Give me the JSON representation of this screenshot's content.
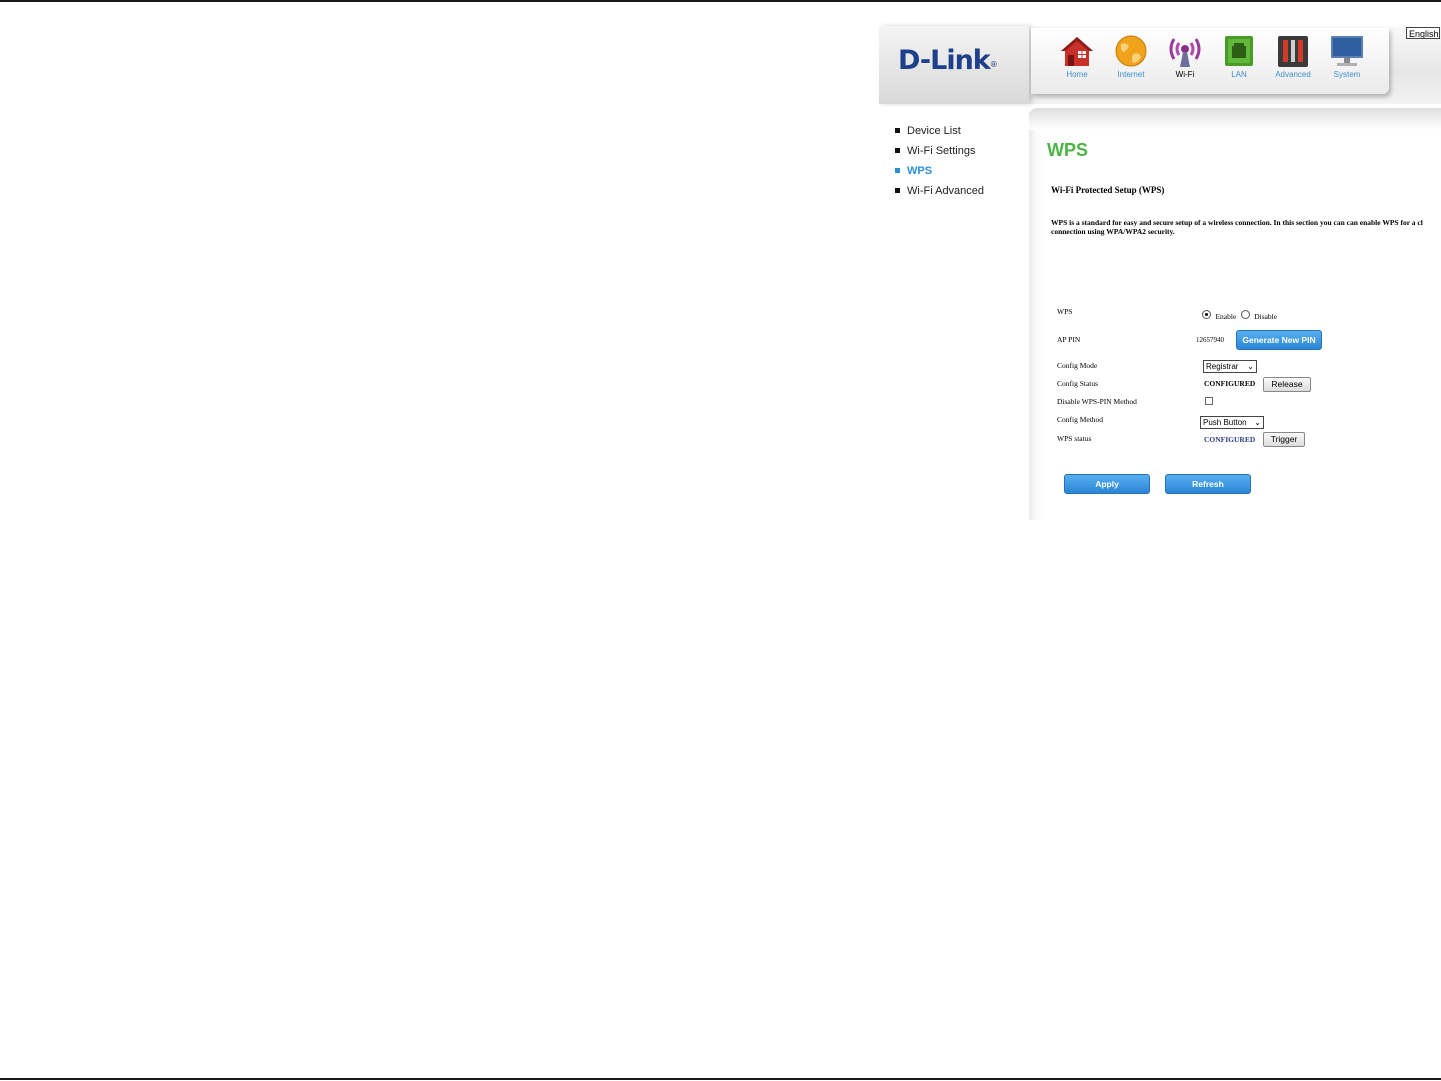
{
  "language": "English",
  "brand": {
    "logo_text": "D-Link",
    "reg_mark": "®"
  },
  "nav": [
    {
      "label": "Home",
      "icon": "home-icon"
    },
    {
      "label": "Internet",
      "icon": "globe-icon"
    },
    {
      "label": "Wi-Fi",
      "icon": "wifi-antenna-icon",
      "active": true
    },
    {
      "label": "LAN",
      "icon": "lan-port-icon"
    },
    {
      "label": "Advanced",
      "icon": "tools-icon"
    },
    {
      "label": "System",
      "icon": "monitor-icon"
    }
  ],
  "sidebar": {
    "items": [
      {
        "label": "Device List"
      },
      {
        "label": "Wi-Fi Settings"
      },
      {
        "label": "WPS",
        "active": true
      },
      {
        "label": "Wi-Fi Advanced"
      }
    ]
  },
  "page": {
    "title": "WPS",
    "section_title": "Wi-Fi Protected Setup (WPS)",
    "desc_line1": "WPS is a standard for easy and secure setup of a wireless connection. In this section you can can enable WPS for a cl",
    "desc_line2": "connection using WPA/WPA2 security."
  },
  "form": {
    "wps_label": "WPS",
    "enable_label": "Enable",
    "disable_label": "Disable",
    "wps_enabled": true,
    "ap_pin_label": "AP PIN",
    "ap_pin_value": "12657940",
    "generate_pin_button": "Generate New PIN",
    "config_mode_label": "Config Mode",
    "config_mode_value": "Registrar",
    "config_status_label": "Config Status",
    "config_status_value": "CONFIGURED",
    "release_button": "Release",
    "disable_pin_label": "Disable WPS-PIN Method",
    "disable_pin_checked": false,
    "config_method_label": "Config Method",
    "config_method_value": "Push Button",
    "wps_status_label": "WPS status",
    "wps_status_value": "CONFIGURED",
    "trigger_button": "Trigger"
  },
  "actions": {
    "apply": "Apply",
    "refresh": "Refresh"
  },
  "colors": {
    "title_green": "#4bb543",
    "accent_blue": "#2b8fd6",
    "logo_blue": "#1d3f8c"
  }
}
